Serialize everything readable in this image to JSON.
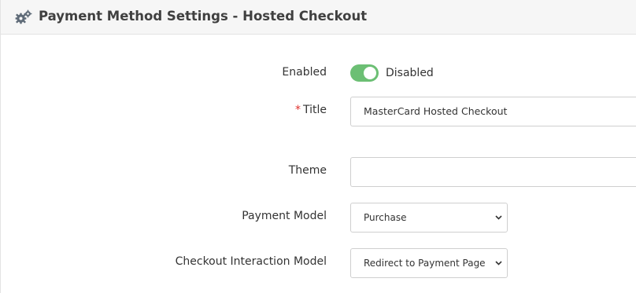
{
  "header": {
    "icon": "gears-icon",
    "title": "Payment Method Settings - Hosted Checkout"
  },
  "form": {
    "enabled": {
      "label": "Enabled",
      "state_text": "Disabled",
      "toggle_color": "#6cbf74"
    },
    "title": {
      "required_mark": "*",
      "label": "Title",
      "value": "MasterCard Hosted Checkout"
    },
    "theme": {
      "label": "Theme",
      "value": ""
    },
    "payment_model": {
      "label": "Payment Model",
      "selected": "Purchase"
    },
    "checkout_interaction_model": {
      "label": "Checkout Interaction Model",
      "selected": "Redirect to Payment Page"
    }
  }
}
